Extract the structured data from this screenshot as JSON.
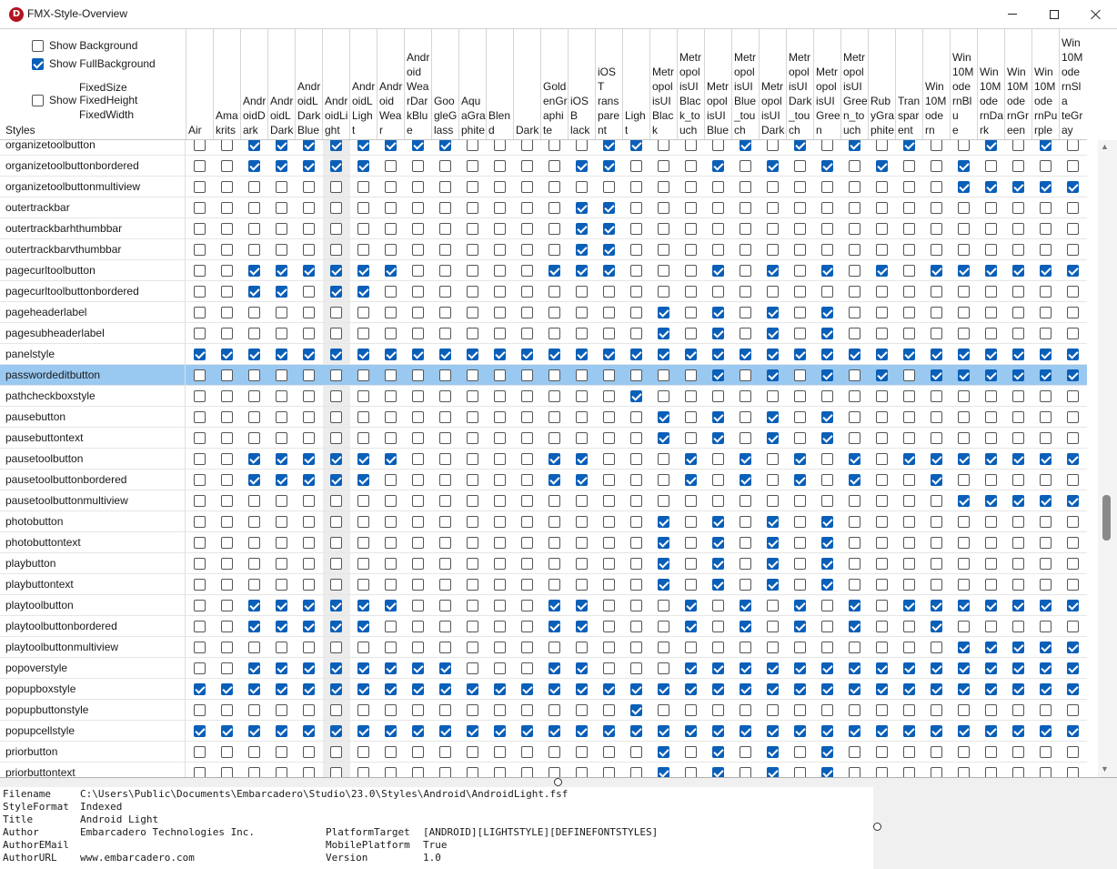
{
  "window": {
    "title": "FMX-Style-Overview",
    "logo_letter": "D",
    "minimize_icon": "minimize-icon",
    "maximize_icon": "maximize-icon",
    "close_icon": "close-icon"
  },
  "options": {
    "show_background": {
      "label": "Show Background",
      "checked": false
    },
    "show_full_background": {
      "label": "Show FullBackground",
      "checked": true
    },
    "fixed_size": "FixedSize",
    "show_fixed_height": {
      "label": "Show FixedHeight",
      "checked": false
    },
    "fixed_width": "FixedWidth"
  },
  "grid": {
    "styles_header": "Styles",
    "columns": [
      "Air",
      "Amakrits",
      "AndroidDark",
      "AndroidLDark",
      "AndroidLDarkBlue",
      "AndroidLight",
      "AndroidLight",
      "AndroidWear",
      "AndroidWearDarkBlue",
      "GoogleGlass",
      "AquaGraphite",
      "Blend",
      "Dark",
      "GoldenGraphite",
      "iOSBlack",
      "iOSTransparent",
      "Light",
      "MetropolisUIBlack",
      "MetropolisUIBlack_touch",
      "MetropolisUIBlue",
      "MetropolisUIBlue_touch",
      "MetropolisUIDark",
      "MetropolisUIDark_touch",
      "MetropolisUIGreen",
      "MetropolisUIGreen_touch",
      "RubyGraphite",
      "Transparent",
      "Win10Modern",
      "Win10ModernBlue",
      "Win10ModernDark",
      "Win10ModernGreen",
      "Win10ModernPurple",
      "Win10ModernSlateGray"
    ],
    "column_headers_display": [
      "Air",
      "Ama\nkrits",
      "Andr\noidD\nark",
      "Andr\noidL\nDark",
      "Andr\noidL\nDark\nBlue",
      "Andr\noidLi\nght",
      "Andr\noidL\nLigh\nt",
      "Andr\noid\nWea\nr",
      "Andr\noid\nWea\nrDar\nkBlu\ne",
      "Goo\ngleG\nlass",
      "Aqu\naGra\nphite",
      "Blen\nd",
      "Dark",
      "Gold\nenGr\naphi\nte",
      "iOSB\nlack",
      "iOST\nrans\npare\nnt",
      "Ligh\nt",
      "Metr\nopol\nisUI\nBlac\nk",
      "Metr\nopol\nisUI\nBlac\nk_to\nuch",
      "Metr\nopol\nisUI\nBlue",
      "Metr\nopol\nisUI\nBlue\n_tou\nch",
      "Metr\nopol\nisUI\nDark",
      "Metr\nopol\nisUI\nDark\n_tou\nch",
      "Metr\nopol\nisUI\nGree\nn",
      "Metr\nopol\nisUI\nGree\nn_to\nuch",
      "Rub\nyGra\nphite",
      "Tran\nspar\nent",
      "Win\n10M\node\nrn",
      "Win\n10M\node\nrnBlu\ne",
      "Win\n10M\node\nrnDa\nrk",
      "Win\n10M\node\nrnGr\neen",
      "Win\n10M\node\nrnPu\nrple",
      "Win\n10M\node\nrnSla\nteGr\nay"
    ],
    "selected_row": "passwordeditbutton",
    "rows": [
      {
        "name": "organizetoolbutton",
        "checks": "0011111111000001100010101010010101"
      },
      {
        "name": "organizetoolbuttonbordered",
        "checks": "0011111000000011000101010100100000"
      },
      {
        "name": "organizetoolbuttonmultiview",
        "checks": "0000000000000000000000000000111111"
      },
      {
        "name": "outertrackbar",
        "checks": "0000000000000011000000000000000000"
      },
      {
        "name": "outertrackbarhthumbbar",
        "checks": "0000000000000011000000000000000000"
      },
      {
        "name": "outertrackbarvthumbbar",
        "checks": "0000000000000011000000000000000000"
      },
      {
        "name": "pagecurltoolbutton",
        "checks": "0011111100000111000101010101111111"
      },
      {
        "name": "pagecurltoolbuttonbordered",
        "checks": "0011011000000000000000000000000000"
      },
      {
        "name": "pageheaderlabel",
        "checks": "0000000000000000010101010000000000"
      },
      {
        "name": "pagesubheaderlabel",
        "checks": "0000000000000000010101010000000000"
      },
      {
        "name": "panelstyle",
        "checks": "1111111111111111111111111111111111"
      },
      {
        "name": "passwordeditbutton",
        "checks": "0000000000000000000101010101111111"
      },
      {
        "name": "pathcheckboxstyle",
        "checks": "0000000000000000100000000000000000"
      },
      {
        "name": "pausebutton",
        "checks": "0000000000000000010101010000000000"
      },
      {
        "name": "pausebuttontext",
        "checks": "0000000000000000010101010000000000"
      },
      {
        "name": "pausetoolbutton",
        "checks": "0011111100000110001010101011111110"
      },
      {
        "name": "pausetoolbuttonbordered",
        "checks": "0011111000000110001010101001000000"
      },
      {
        "name": "pausetoolbuttonmultiview",
        "checks": "0000000000000000000000000000111111"
      },
      {
        "name": "photobutton",
        "checks": "0000000000000000010101010000000000"
      },
      {
        "name": "photobuttontext",
        "checks": "0000000000000000010101010000000000"
      },
      {
        "name": "playbutton",
        "checks": "0000000000000000010101010000000000"
      },
      {
        "name": "playbuttontext",
        "checks": "0000000000000000010101010000000000"
      },
      {
        "name": "playtoolbutton",
        "checks": "0011111100000110001010101011111110"
      },
      {
        "name": "playtoolbuttonbordered",
        "checks": "0011111000000110001010101001000000"
      },
      {
        "name": "playtoolbuttonmultiview",
        "checks": "0000000000000000000000000000111111"
      },
      {
        "name": "popoverstyle",
        "checks": "0011111111000110001111111111111110"
      },
      {
        "name": "popupboxstyle",
        "checks": "1111111111111111111111111111111110"
      },
      {
        "name": "popupbuttonstyle",
        "checks": "0000000000000000100000000000000000"
      },
      {
        "name": "popupcellstyle",
        "checks": "1111111111111111111111111111111110"
      },
      {
        "name": "priorbutton",
        "checks": "0000000000000000010101010000000000"
      },
      {
        "name": "priorbuttontext",
        "checks": "0000000000000000010101010000000000"
      }
    ]
  },
  "info": {
    "lines": [
      {
        "key": "Filename",
        "value": "C:\\Users\\Public\\Documents\\Embarcadero\\Studio\\23.0\\Styles\\Android\\AndroidLight.fsf",
        "key2": "",
        "value2": ""
      },
      {
        "key": "StyleFormat",
        "value": "Indexed",
        "key2": "",
        "value2": ""
      },
      {
        "key": "Title",
        "value": "Android Light",
        "key2": "",
        "value2": ""
      },
      {
        "key": "Author",
        "value": "Embarcadero Technologies Inc.",
        "key2": "PlatformTarget",
        "value2": "[ANDROID][LIGHTSTYLE][DEFINEFONTSTYLES]"
      },
      {
        "key": "AuthorEMail",
        "value": "",
        "key2": "MobilePlatform",
        "value2": "True"
      },
      {
        "key": "AuthorURL",
        "value": "www.embarcadero.com",
        "key2": "Version",
        "value2": "1.0"
      }
    ]
  },
  "colors": {
    "checked": "#0a5fb8",
    "selected_row": "#99c8f0",
    "highlight_column": "#ececec",
    "logo": "#b3121f"
  }
}
